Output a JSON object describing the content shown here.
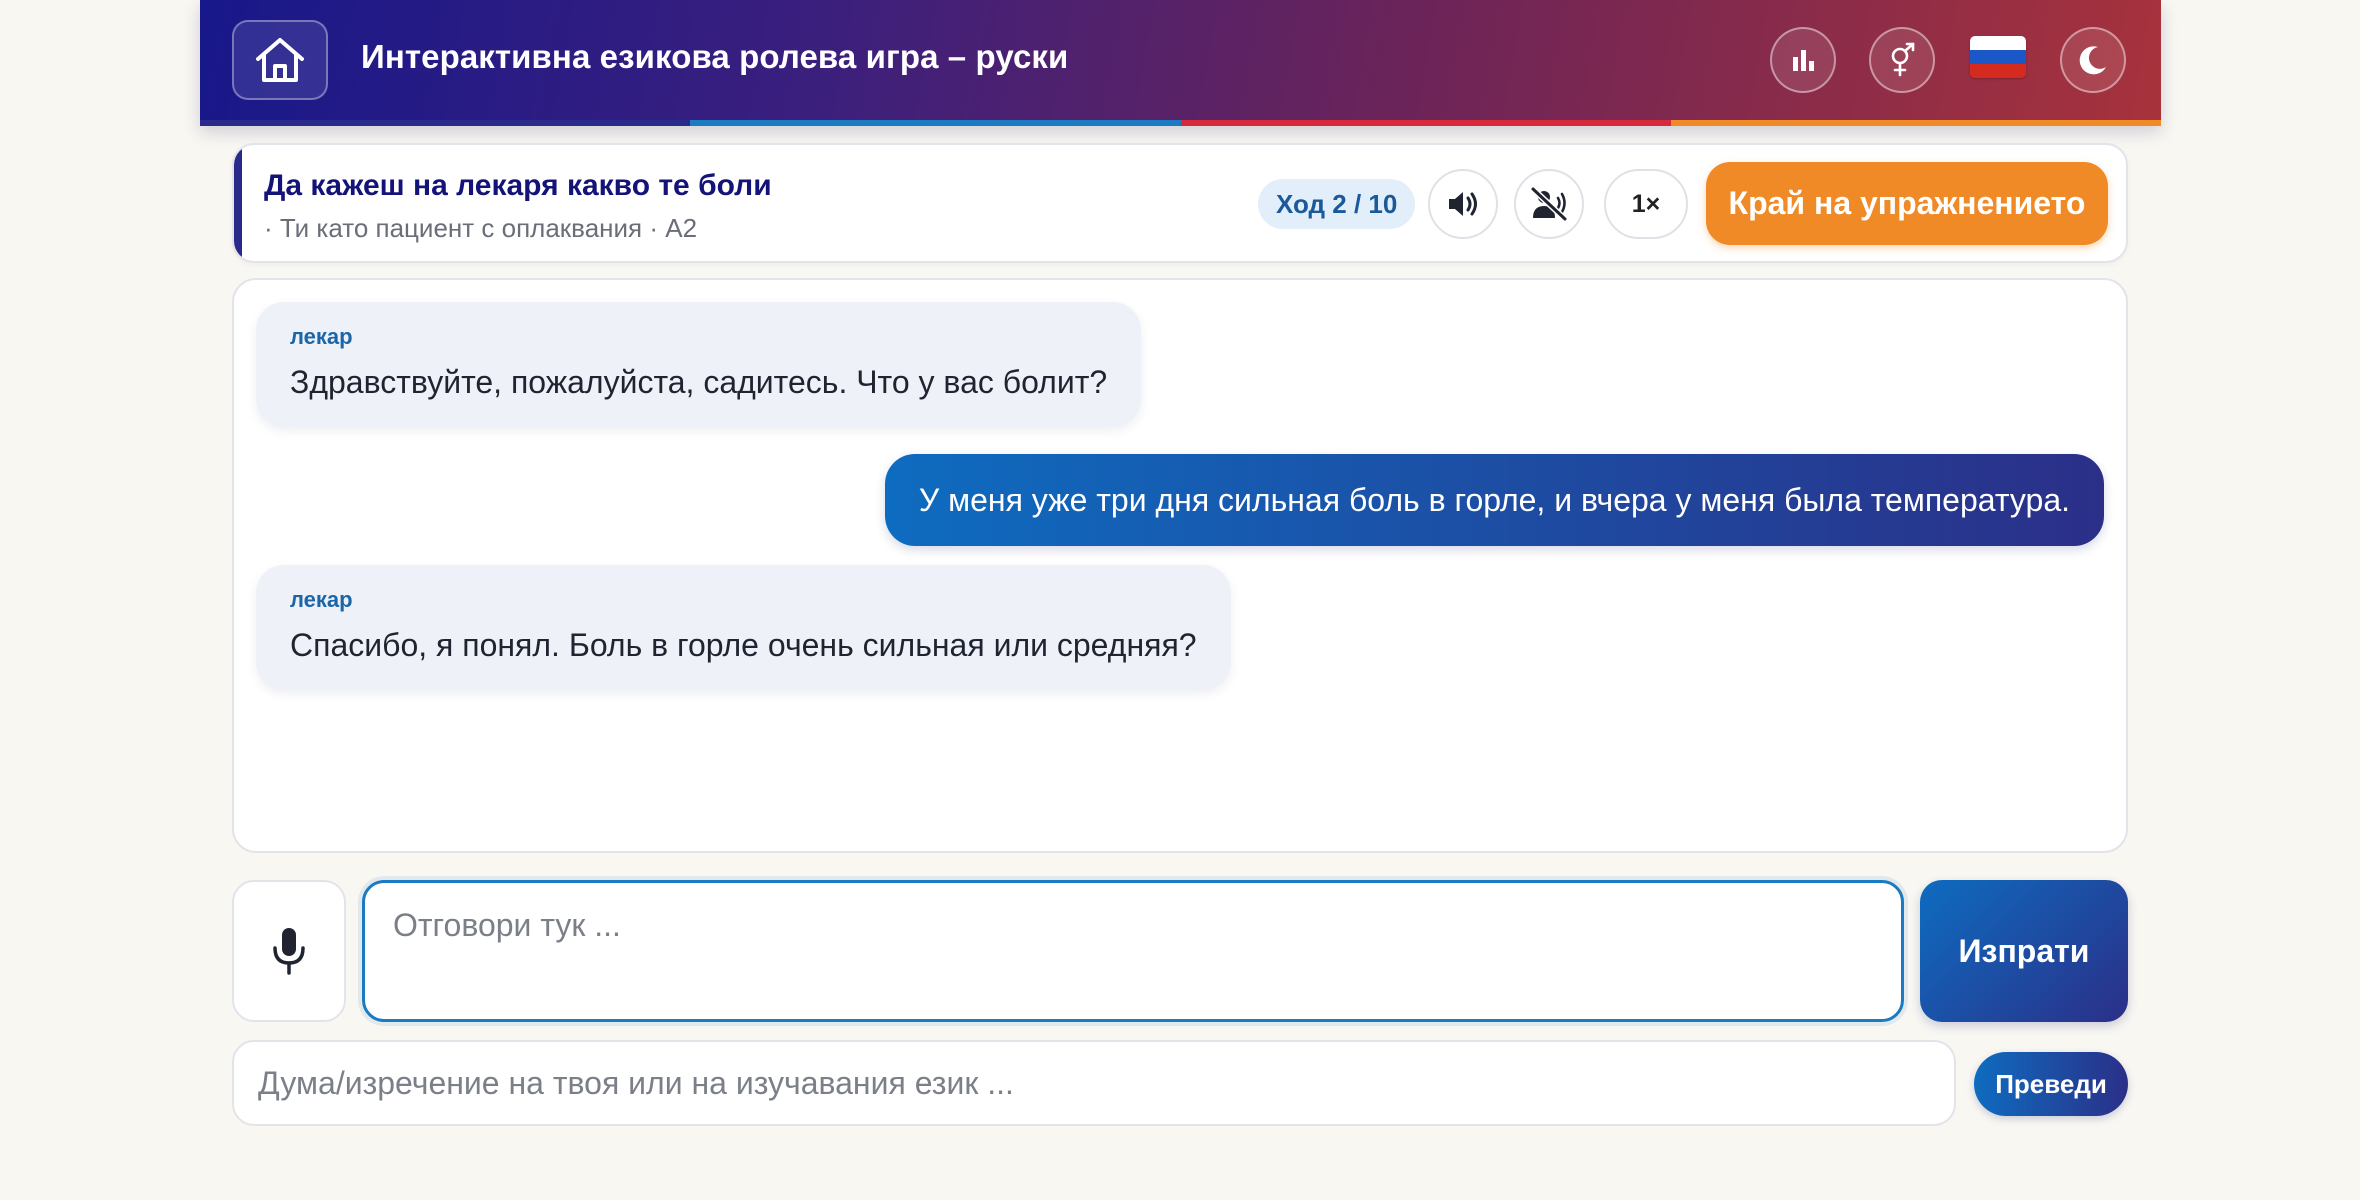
{
  "header": {
    "title": "Интерактивна езикова ролева игра – руски",
    "icons": {
      "home": "home-icon",
      "stats": "bar-chart-icon",
      "gender": "gender-icon",
      "language_flag": "russia-flag",
      "theme": "moon-icon"
    },
    "stripe_colors": [
      "#2a2a8a",
      "#1a7ac2",
      "#d8283c",
      "#f08a26"
    ]
  },
  "scenario": {
    "title": "Да кажеш на лекаря какво те боли",
    "subtitle": "· Ти като пациент с оплаквания · A2",
    "turn": "Ход 2 / 10",
    "speed": "1×",
    "end_button": "Край на упражнението",
    "icons": {
      "audio": "speaker-icon",
      "mute": "mute-icon"
    }
  },
  "messages": [
    {
      "role": "npc",
      "speaker": "лекар",
      "text": "Здравствуйте, пожалуйста, садитесь. Что у вас болит?"
    },
    {
      "role": "user",
      "text": "У меня уже три дня сильная боль в горле, и вчера у меня была температура."
    },
    {
      "role": "npc",
      "speaker": "лекар",
      "text": "Спасибо, я понял. Боль в горле очень сильная или средняя?"
    }
  ],
  "input": {
    "placeholder": "Отговори тук ...",
    "value": "",
    "send_label": "Изпрати",
    "mic_icon": "microphone-icon"
  },
  "phrase": {
    "placeholder": "Дума/изречение на твоя или на изучавания език ...",
    "translate_label": "Преведи"
  },
  "colors": {
    "accent_blue": "#1a7ac2",
    "accent_indigo": "#2b2f88",
    "accent_orange": "#f08a26",
    "page_bg": "#f8f7f2"
  }
}
